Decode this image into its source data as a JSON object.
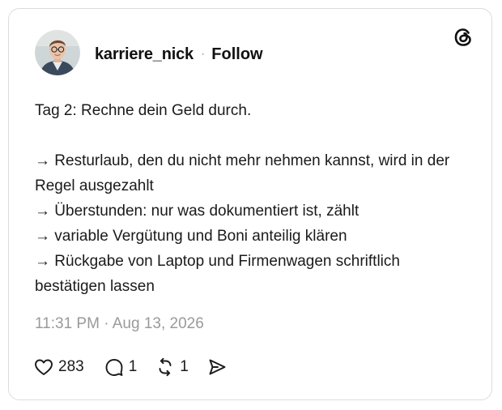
{
  "post": {
    "author": {
      "username": "karriere_nick",
      "separator": "·",
      "follow_label": "Follow",
      "avatar_icon": "profile-photo"
    },
    "brand_icon": "threads-logo-icon",
    "lines": [
      "Tag 2: Rechne dein Geld durch.",
      "",
      "→ Resturlaub, den du nicht mehr nehmen kannst, wird in der Regel ausgezahlt",
      "→ Überstunden: nur was dokumentiert ist, zählt",
      "→ variable Vergütung und Boni anteilig klären",
      "→ Rückgabe von Laptop und Firmenwagen schriftlich bestätigen lassen"
    ],
    "timestamp": "11:31 PM · Aug 13, 2026",
    "actions": {
      "like": {
        "icon": "heart-icon",
        "count": "283"
      },
      "reply": {
        "icon": "comment-icon",
        "count": "1"
      },
      "repost": {
        "icon": "repost-icon",
        "count": "1"
      },
      "share": {
        "icon": "share-icon"
      }
    }
  },
  "colors": {
    "text": "#111111",
    "muted": "#9a9a9a",
    "border": "#dcdcdc",
    "background": "#ffffff"
  }
}
